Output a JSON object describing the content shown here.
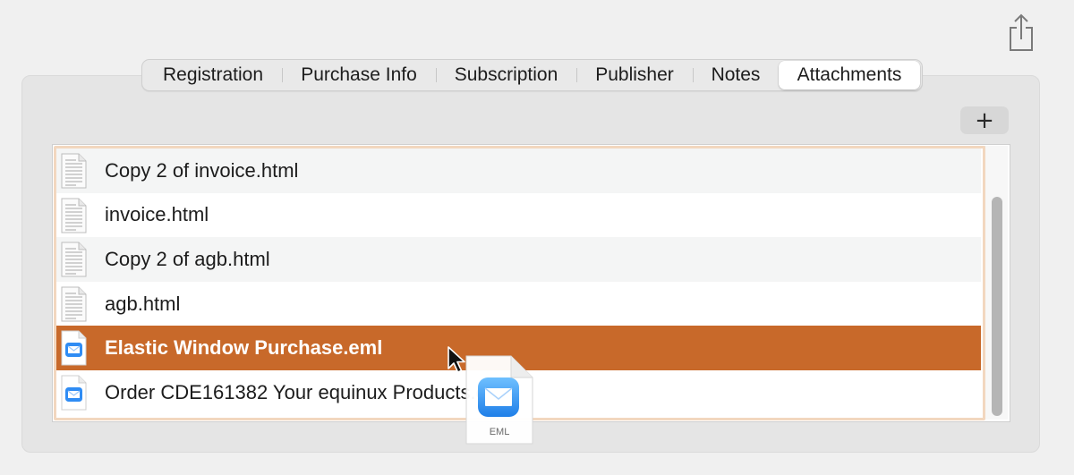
{
  "toolbar": {
    "share_icon": "share-icon"
  },
  "tabs": [
    {
      "label": "Registration",
      "active": false
    },
    {
      "label": "Purchase Info",
      "active": false
    },
    {
      "label": "Subscription",
      "active": false
    },
    {
      "label": "Publisher",
      "active": false
    },
    {
      "label": "Notes",
      "active": false
    },
    {
      "label": "Attachments",
      "active": true
    }
  ],
  "add_button": {
    "label": "+"
  },
  "attachments": [
    {
      "name": "Copy 2 of invoice.html",
      "icon": "html-file-icon",
      "selected": false
    },
    {
      "name": "invoice.html",
      "icon": "html-file-icon",
      "selected": false
    },
    {
      "name": "Copy 2 of agb.html",
      "icon": "html-file-icon",
      "selected": false
    },
    {
      "name": "agb.html",
      "icon": "html-file-icon",
      "selected": false
    },
    {
      "name": "Elastic Window Purchase.eml",
      "icon": "eml-file-icon",
      "selected": true
    },
    {
      "name": "Order CDE161382 Your equinux Products.eml",
      "icon": "eml-file-icon",
      "selected": false
    }
  ],
  "drag_preview": {
    "label": "EML",
    "icon": "eml-document-icon"
  },
  "colors": {
    "selection": "#c8692a",
    "focus_ring": "#f2d7bf"
  }
}
